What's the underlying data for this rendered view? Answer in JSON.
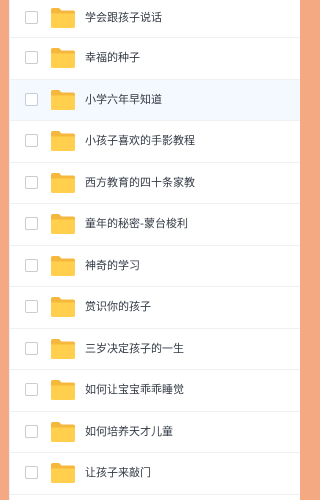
{
  "colors": {
    "background_peach": "#f4a983",
    "folder_yellow": "#ffcf4d",
    "folder_tab": "#f5b83c",
    "row_highlight": "#f3f9fe"
  },
  "file_list": {
    "icon": "folder-icon",
    "items": [
      {
        "name": "学会跟孩子说话",
        "checked": false,
        "highlighted": false
      },
      {
        "name": "幸福的种子",
        "checked": false,
        "highlighted": false
      },
      {
        "name": "小学六年早知道",
        "checked": false,
        "highlighted": true
      },
      {
        "name": "小孩子喜欢的手影教程",
        "checked": false,
        "highlighted": false
      },
      {
        "name": "西方教育的四十条家教",
        "checked": false,
        "highlighted": false
      },
      {
        "name": "童年的秘密-蒙台梭利",
        "checked": false,
        "highlighted": false
      },
      {
        "name": "神奇的学习",
        "checked": false,
        "highlighted": false
      },
      {
        "name": "赏识你的孩子",
        "checked": false,
        "highlighted": false
      },
      {
        "name": "三岁决定孩子的一生",
        "checked": false,
        "highlighted": false
      },
      {
        "name": "如何让宝宝乖乖睡觉",
        "checked": false,
        "highlighted": false
      },
      {
        "name": "如何培养天才儿童",
        "checked": false,
        "highlighted": false
      },
      {
        "name": "让孩子来敲门",
        "checked": false,
        "highlighted": false
      }
    ]
  }
}
